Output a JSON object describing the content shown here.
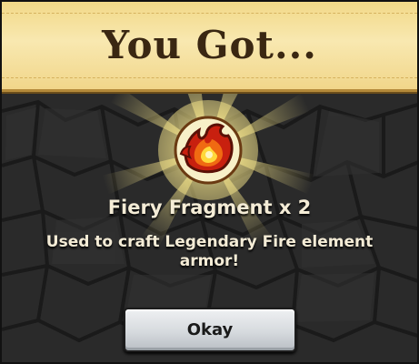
{
  "banner": {
    "title": "You Got..."
  },
  "reward": {
    "icon": "fiery-fragment-icon",
    "name": "Fiery Fragment x 2",
    "description": "Used to craft Legendary Fire element armor!"
  },
  "actions": {
    "okay_label": "Okay"
  },
  "colors": {
    "banner": "#f5e3a1",
    "background": "#2b2b2b",
    "text": "#f4ecd6",
    "button": "#d6dade"
  }
}
